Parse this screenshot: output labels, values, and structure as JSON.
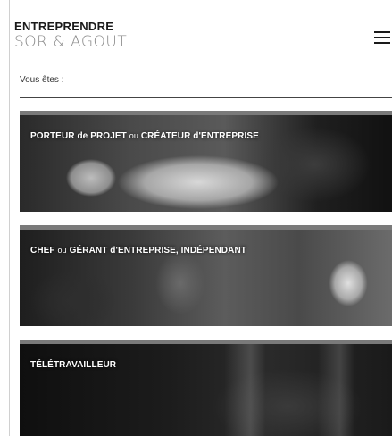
{
  "header": {
    "logo_line1": "ENTREPRENDRE",
    "logo_line2": "SOR & AGOUT"
  },
  "menu": {
    "icon": "hamburger-menu-icon"
  },
  "profile_prompt": "Vous êtes :",
  "cards": [
    {
      "title_a": "PORTEUR de PROJET ",
      "title_b": "ou",
      "title_c": " CRÉATEUR d'ENTREPRISE"
    },
    {
      "title_a": "CHEF ",
      "title_b": "ou",
      "title_c": " GÉRANT d'ENTREPRISE, INDÉPENDANT"
    },
    {
      "title_a": "TÉLÉTRAVAILLEUR"
    }
  ]
}
